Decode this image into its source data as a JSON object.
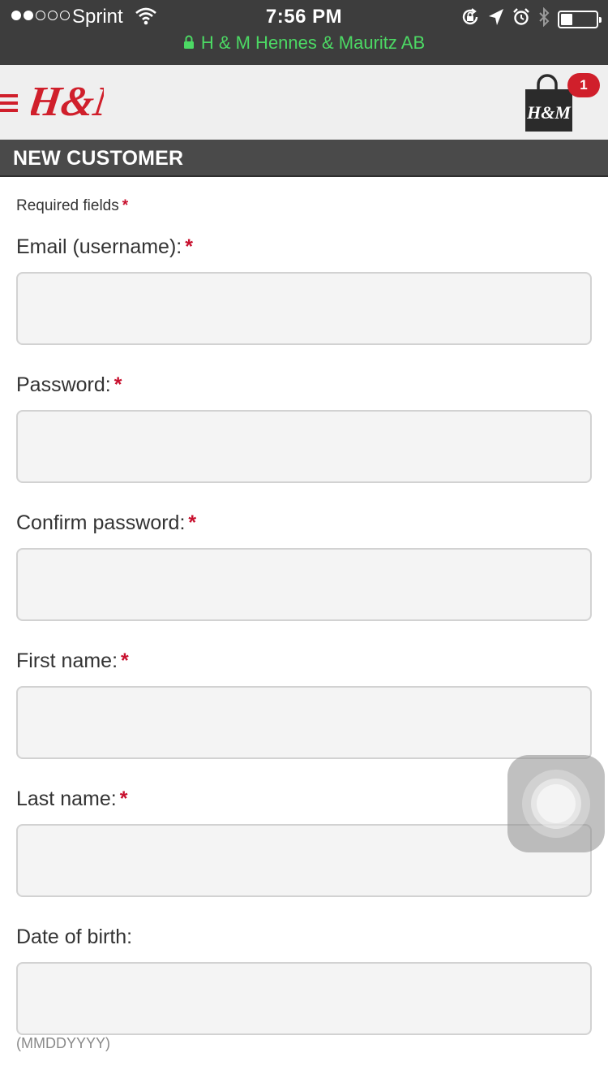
{
  "status_bar": {
    "signal_filled": 2,
    "signal_total": 5,
    "carrier": "Sprint",
    "time": "7:56 PM",
    "icons": [
      "wifi-icon",
      "rotation-lock-icon",
      "location-icon",
      "alarm-icon",
      "bluetooth-icon",
      "battery-icon"
    ],
    "battery_level": 0.3,
    "site_name": "H & M Hennes & Mauritz AB",
    "site_color": "#4cd964"
  },
  "header": {
    "logo_text": "H&M",
    "brand_color": "#d01f2b",
    "cart_logo_text": "H&M",
    "cart_count": "1"
  },
  "section": {
    "title": "NEW CUSTOMER"
  },
  "form": {
    "required_note": "Required fields",
    "required_marker": "*",
    "fields": [
      {
        "label": "Email (username):",
        "value": "",
        "required": true
      },
      {
        "label": "Password:",
        "value": "",
        "required": true
      },
      {
        "label": "Confirm password:",
        "value": "",
        "required": true
      },
      {
        "label": "First name:",
        "value": "",
        "required": true
      },
      {
        "label": "Last name:",
        "value": "",
        "required": true
      },
      {
        "label": "Date of birth:",
        "value": "",
        "required": false
      }
    ],
    "dob_hint": "(MMDDYYYY)"
  }
}
